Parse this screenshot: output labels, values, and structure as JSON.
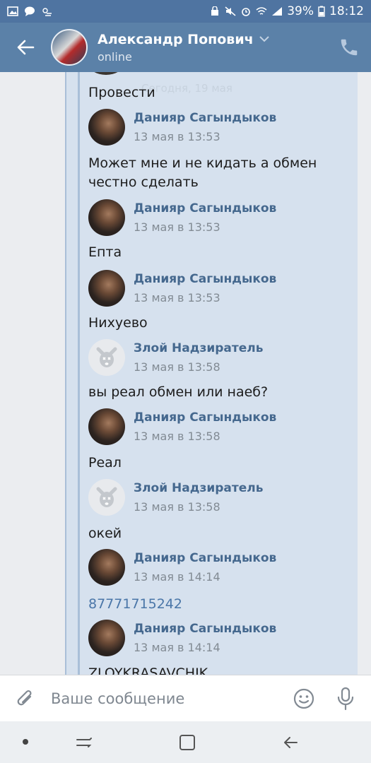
{
  "status_bar": {
    "battery": "39%",
    "time": "18:12"
  },
  "header": {
    "name": "Александр Попович",
    "status": "online"
  },
  "chat": {
    "date_separator": "Сегодня, 19 мая",
    "items": [
      {
        "kind": "text",
        "text": "Провести"
      },
      {
        "kind": "author",
        "avatar": "dark",
        "name": "Данияр Сагындыков",
        "time": "13 мая в 13:53"
      },
      {
        "kind": "text",
        "text": "Может мне и не кидать а обмен\nчестно сделать"
      },
      {
        "kind": "author",
        "avatar": "dark",
        "name": "Данияр Сагындыков",
        "time": "13 мая в 13:53"
      },
      {
        "kind": "text",
        "text": "Епта"
      },
      {
        "kind": "author",
        "avatar": "dark",
        "name": "Данияр Сагындыков",
        "time": "13 мая в 13:53"
      },
      {
        "kind": "text",
        "text": "Нихуево"
      },
      {
        "kind": "author",
        "avatar": "dog",
        "name": "Злой Надзиратель",
        "time": "13 мая в 13:58"
      },
      {
        "kind": "text",
        "text": "вы реал обмен или наеб?"
      },
      {
        "kind": "author",
        "avatar": "dark",
        "name": "Данияр Сагындыков",
        "time": "13 мая в 13:58"
      },
      {
        "kind": "text",
        "text": "Реал"
      },
      {
        "kind": "author",
        "avatar": "dog",
        "name": "Злой Надзиратель",
        "time": "13 мая в 13:58"
      },
      {
        "kind": "text",
        "text": "окей"
      },
      {
        "kind": "author",
        "avatar": "dark",
        "name": "Данияр Сагындыков",
        "time": "13 мая в 14:14"
      },
      {
        "kind": "link",
        "text": "87771715242"
      },
      {
        "kind": "author",
        "avatar": "dark",
        "name": "Данияр Сагындыков",
        "time": "13 мая в 14:14"
      },
      {
        "kind": "text",
        "text": "ZLOYKRASAVCHIK"
      }
    ]
  },
  "input": {
    "placeholder": "Ваше сообщение"
  },
  "colors": {
    "header": "#5b81a8",
    "status_bar": "#4f74a1",
    "author_name": "#45688e",
    "link": "#4a76a8",
    "forward_bg": "#d6e1ee"
  },
  "icons": [
    "gallery-icon",
    "chat-bubble-icon",
    "weather-icon",
    "vpn-key-icon",
    "mute-icon",
    "alarm-icon",
    "wifi-icon",
    "signal-icon",
    "battery-icon",
    "back-arrow-icon",
    "chevron-down-icon",
    "phone-icon",
    "attach-icon",
    "smile-icon",
    "mic-icon"
  ]
}
